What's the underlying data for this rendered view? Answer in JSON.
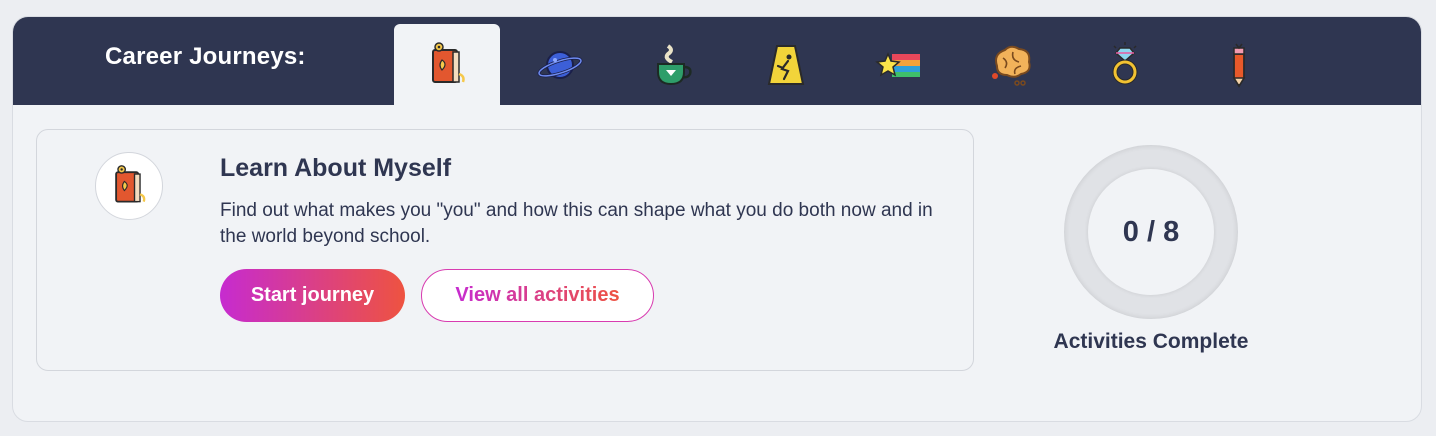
{
  "header": {
    "title": "Career Journeys:"
  },
  "tabs": [
    {
      "icon": "book-icon",
      "active": true
    },
    {
      "icon": "planet-icon",
      "active": false
    },
    {
      "icon": "coffee-cup-icon",
      "active": false
    },
    {
      "icon": "wet-floor-sign-icon",
      "active": false
    },
    {
      "icon": "shooting-star-icon",
      "active": false
    },
    {
      "icon": "brain-icon",
      "active": false
    },
    {
      "icon": "diamond-ring-icon",
      "active": false
    },
    {
      "icon": "pencil-icon",
      "active": false
    }
  ],
  "journey": {
    "title": "Learn About Myself",
    "description": "Find out what makes you \"you\" and how this can shape what you do both now and in the world beyond school.",
    "start_label": "Start journey",
    "view_label": "View all activities"
  },
  "progress": {
    "value": "0 / 8",
    "completed": 0,
    "total": 8,
    "label": "Activities Complete"
  },
  "colors": {
    "header_bg": "#2f3651",
    "accent_start": "#c62bd0",
    "accent_end": "#ee5340",
    "text": "#2f3651"
  }
}
